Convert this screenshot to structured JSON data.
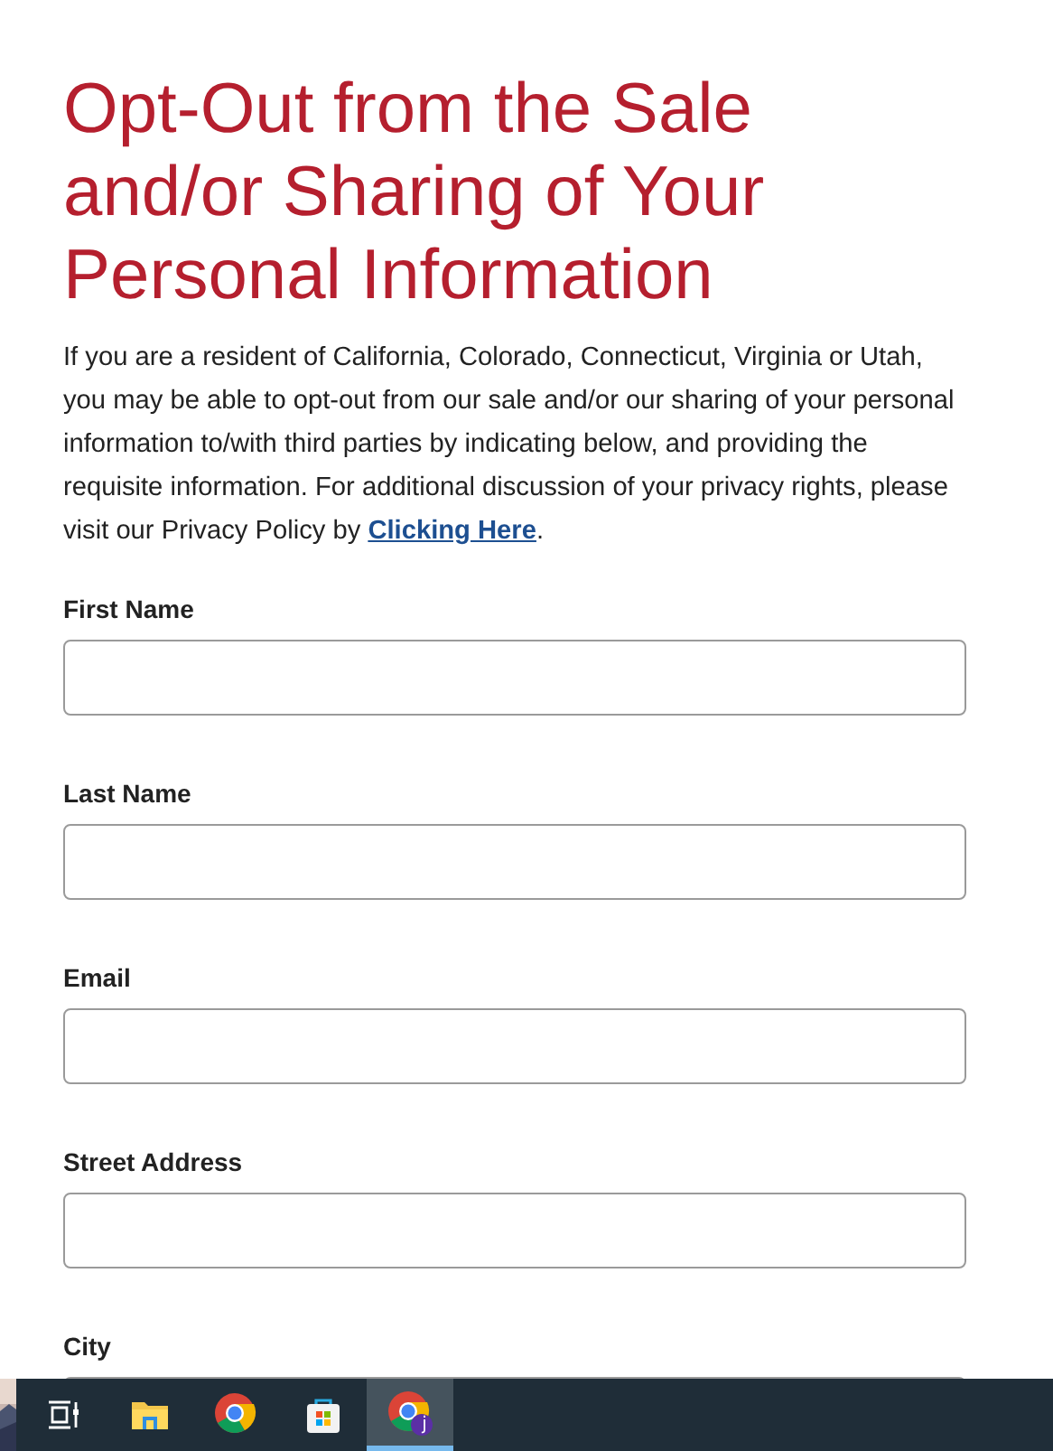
{
  "heading": "Opt-Out from the Sale and/or Sharing of Your Personal Information",
  "intro": {
    "text_before": "If you are a resident of California, Colorado, Connecticut, Virginia or Utah, you may be able to opt-out from our sale and/or our sharing of your personal information to/with third parties by indicating below, and providing the requisite information. For additional discussion of your privacy rights, please visit our Privacy Policy by ",
    "link": "Clicking Here",
    "text_after": "."
  },
  "fields": [
    {
      "label": "First Name"
    },
    {
      "label": "Last Name"
    },
    {
      "label": "Email"
    },
    {
      "label": "Street Address"
    },
    {
      "label": "City"
    }
  ],
  "taskbar": {
    "items": [
      {
        "kind": "task-view",
        "selected": false
      },
      {
        "kind": "folder",
        "selected": false
      },
      {
        "kind": "browser",
        "selected": false
      },
      {
        "kind": "store",
        "selected": false
      },
      {
        "kind": "browser-profile",
        "selected": true,
        "badge": "j"
      }
    ]
  }
}
